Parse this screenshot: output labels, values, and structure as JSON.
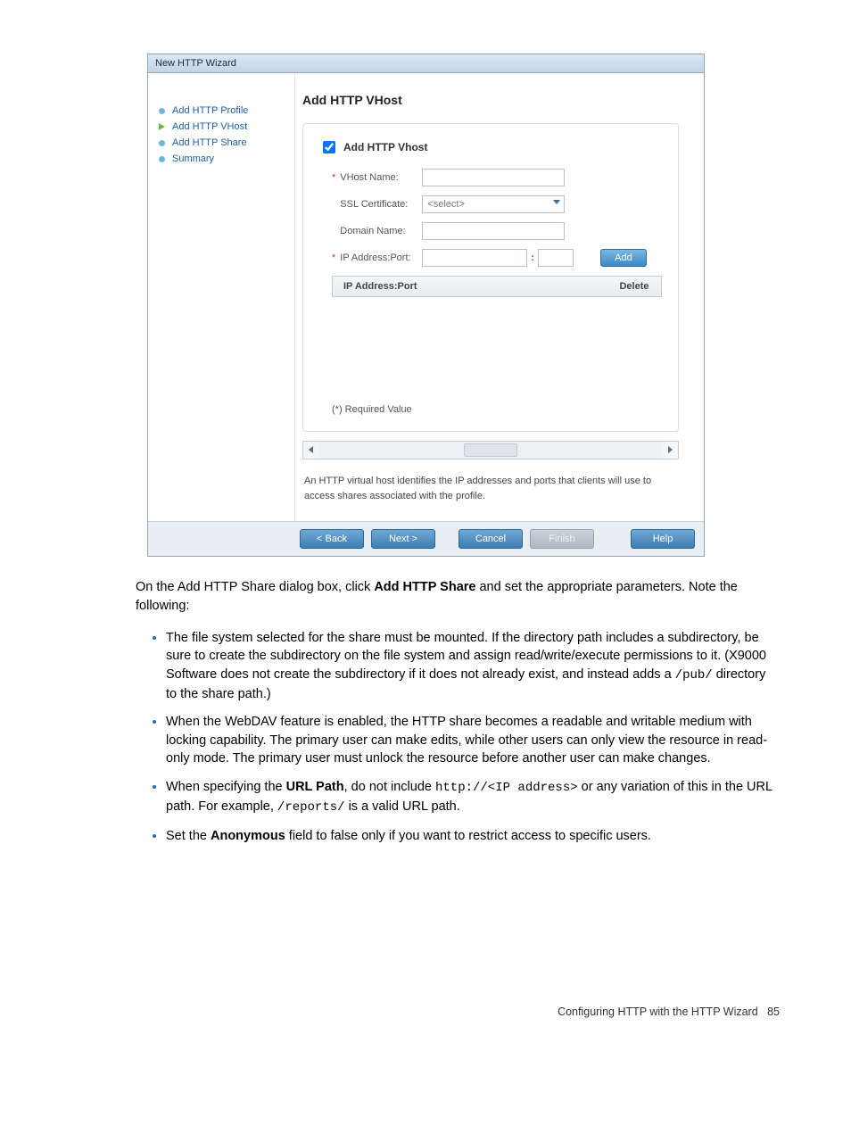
{
  "dialog": {
    "title": "New HTTP Wizard",
    "sidebar": [
      {
        "label": "Add HTTP Profile",
        "active": false
      },
      {
        "label": "Add HTTP VHost",
        "active": true
      },
      {
        "label": "Add HTTP Share",
        "active": false
      },
      {
        "label": "Summary",
        "active": false
      }
    ],
    "heading": "Add HTTP VHost",
    "checkbox_label": "Add HTTP Vhost",
    "checkbox_checked": true,
    "fields": {
      "vhost_label": "VHost Name:",
      "ssl_label": "SSL Certificate:",
      "ssl_placeholder": "<select>",
      "domain_label": "Domain Name:",
      "ipport_label": "IP Address:Port:"
    },
    "add_button": "Add",
    "table": {
      "col1": "IP Address:Port",
      "col2": "Delete"
    },
    "required_text": "(*) Required Value",
    "description": "An HTTP virtual host identifies the IP addresses and ports that clients will use to access shares associated with the profile.",
    "buttons": {
      "back": "< Back",
      "next": "Next >",
      "cancel": "Cancel",
      "finish": "Finish",
      "help": "Help"
    }
  },
  "doc": {
    "intro1": "On the Add HTTP Share dialog box, click ",
    "intro_bold": "Add HTTP Share",
    "intro2": " and set the appropriate parameters. Note the following:",
    "bullets": [
      {
        "html": "The file system selected for the share must be mounted. If the directory path includes a subdirectory, be sure to create the subdirectory on the file system and assign read/write/execute permissions to it. (X9000 Software does not create the subdirectory if it does not already exist, and instead adds a <span class='mono'>/pub/</span> directory to the share path.)"
      },
      {
        "html": "When the WebDAV feature is enabled, the HTTP share becomes a readable and writable medium with locking capability. The primary user can make edits, while other users can only view the resource in read-only mode. The primary user must unlock the resource before another user can make changes."
      },
      {
        "html": "When specifying the <strong>URL Path</strong>, do not include <span class='mono'>http://&lt;IP address&gt;</span> or any variation of this in the URL path. For example, <span class='mono'>/reports/</span> is a valid URL path."
      },
      {
        "html": "Set the <strong>Anonymous</strong> field to false only if you want to restrict access to specific users."
      }
    ]
  },
  "footer": {
    "text": "Configuring HTTP with the HTTP Wizard",
    "page": "85"
  }
}
